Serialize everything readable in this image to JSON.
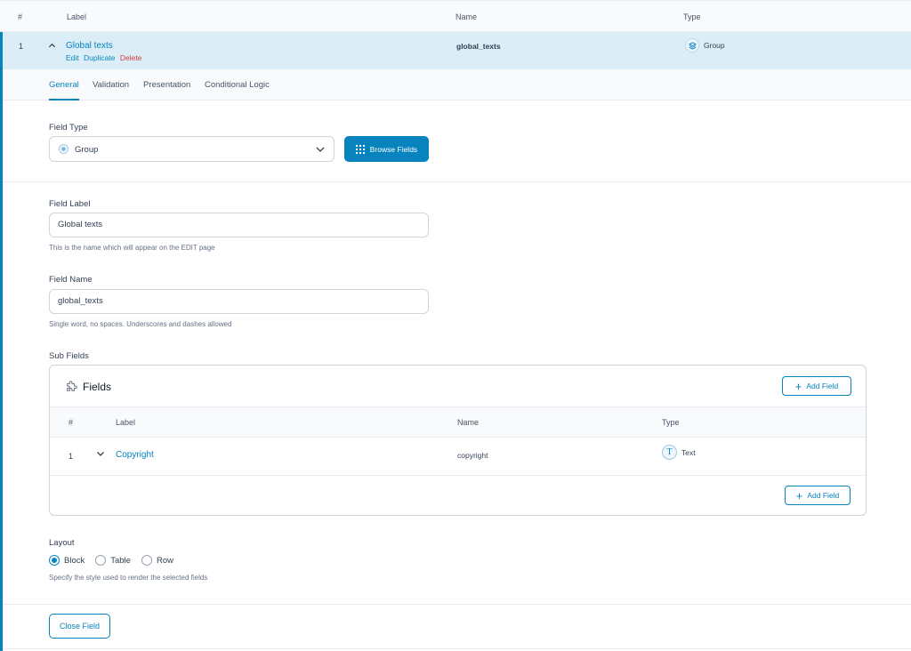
{
  "list_header": {
    "num": "#",
    "label": "Label",
    "name": "Name",
    "type": "Type"
  },
  "field": {
    "number": "1",
    "label": "Global texts",
    "actions": {
      "edit": "Edit",
      "duplicate": "Duplicate",
      "delete": "Delete"
    },
    "name": "global_texts",
    "type": "Group",
    "type_icon": "layers-icon"
  },
  "tabs": [
    "General",
    "Validation",
    "Presentation",
    "Conditional Logic"
  ],
  "field_type": {
    "label": "Field Type",
    "value": "Group",
    "browse_button": "Browse Fields"
  },
  "field_label": {
    "label": "Field Label",
    "value": "Global texts",
    "hint": "This is the name which will appear on the EDIT page"
  },
  "field_name": {
    "label": "Field Name",
    "value": "global_texts",
    "hint": "Single word, no spaces. Underscores and dashes allowed"
  },
  "sub_fields": {
    "label": "Sub Fields",
    "title": "Fields",
    "add_button": "Add Field",
    "columns": {
      "num": "#",
      "label": "Label",
      "name": "Name",
      "type": "Type"
    },
    "rows": [
      {
        "num": "1",
        "label": "Copyright",
        "name": "copyright",
        "type": "Text",
        "type_icon": "T"
      }
    ]
  },
  "layout": {
    "label": "Layout",
    "options": [
      "Block",
      "Table",
      "Row"
    ],
    "selected": "Block",
    "hint": "Specify the style used to render the selected fields"
  },
  "close_button": "Close Field",
  "colors": {
    "accent": "#0783be",
    "row_highlight": "#dbedf7",
    "danger": "#d13d3d"
  }
}
